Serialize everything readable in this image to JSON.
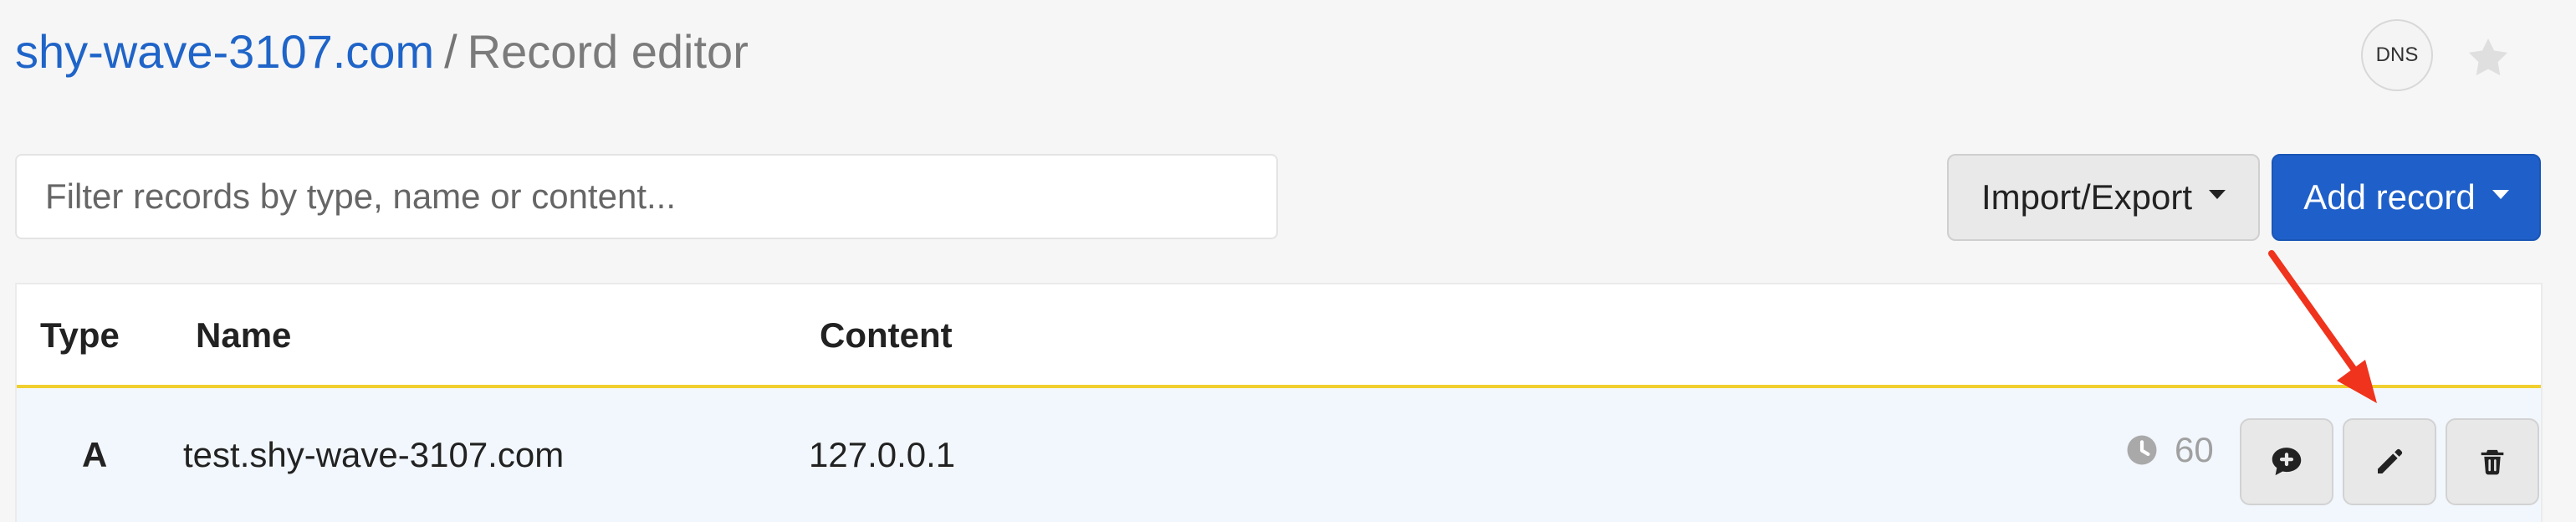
{
  "header": {
    "domain": "shy-wave-3107.com",
    "separator": "/",
    "page_title": "Record editor",
    "dns_badge": "DNS",
    "star_icon": "star-icon"
  },
  "toolbar": {
    "search_placeholder": "Filter records by type, name or content...",
    "import_export_label": "Import/Export",
    "add_record_label": "Add record"
  },
  "table": {
    "columns": [
      "Type",
      "Name",
      "Content"
    ],
    "rows": [
      {
        "type": "A",
        "name": "test.shy-wave-3107.com",
        "content": "127.0.0.1",
        "ttl": "60",
        "ttl_icon": "clock-icon",
        "actions": {
          "comment_icon": "comment-plus-icon",
          "edit_icon": "pencil-icon",
          "delete_icon": "trash-icon"
        }
      }
    ]
  },
  "annotation": {
    "arrow_color": "#f0331c",
    "highlight": "edit-record-button"
  },
  "colors": {
    "primary": "#1f5fc9",
    "link": "#1f64c8",
    "header_rule": "#f1cf2f",
    "row_highlight": "#f2f7fd"
  }
}
